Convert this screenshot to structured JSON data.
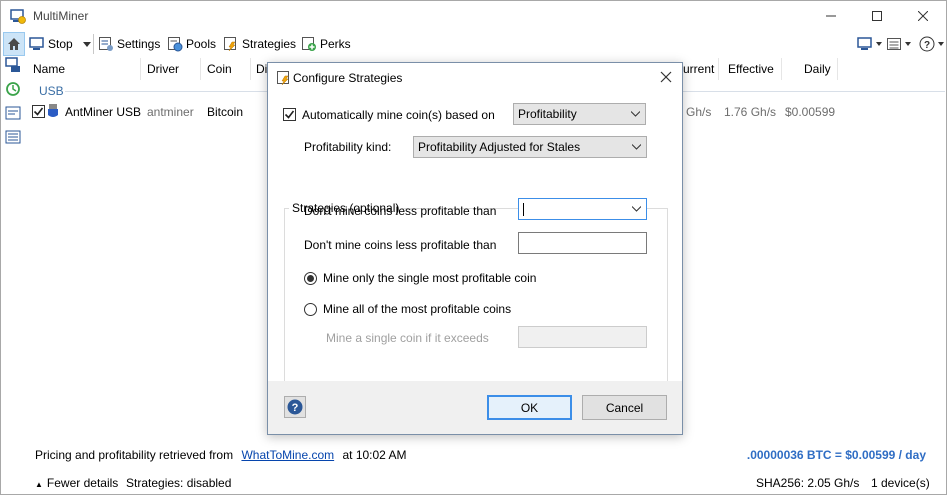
{
  "window": {
    "title": "MultiMiner"
  },
  "toolbar": {
    "stop_label": "Stop",
    "settings_label": "Settings",
    "pools_label": "Pools",
    "strategies_label": "Strategies",
    "perks_label": "Perks"
  },
  "list": {
    "columns": {
      "name": "Name",
      "driver": "Driver",
      "coin": "Coin",
      "difficulty_partial": "Di",
      "current_partial": "urrent",
      "effective": "Effective",
      "daily": "Daily"
    },
    "group_label": "USB",
    "row": {
      "name": "AntMiner USB",
      "driver": "antminer",
      "coin": "Bitcoin",
      "current_partial": "Gh/s",
      "effective": "1.76 Gh/s",
      "daily": "$0.00599"
    }
  },
  "status": {
    "pricing_text": "Pricing and profitability retrieved from",
    "pricing_link": "WhatToMine.com",
    "pricing_time": "at 10:02 AM",
    "earnings": ".00000036 BTC = $0.00599 / day",
    "fewer_details": "Fewer details",
    "strategies_state": "Strategies: disabled",
    "hashrate": "SHA256: 2.05 Gh/s",
    "device_count": "1 device(s)"
  },
  "dialog": {
    "title": "Configure Strategies",
    "auto_mine_label": "Automatically mine coin(s) based on",
    "auto_mine_checked": true,
    "based_on_value": "Profitability",
    "profit_kind_label": "Profitability kind:",
    "profit_kind_value": "Profitability Adjusted for Stales",
    "strategies_group": "Strategies (optional)",
    "min_profit_label_1": "Don't mine coins less profitable than",
    "min_profit_value_1": "",
    "min_profit_label_2": "Don't mine coins less profitable than",
    "min_profit_value_2": "",
    "radio_single": "Mine only the single most profitable coin",
    "radio_all": "Mine all of the most profitable coins",
    "single_threshold_label": "Mine a single coin if it exceeds",
    "single_threshold_value": "",
    "ok_label": "OK",
    "cancel_label": "Cancel"
  },
  "colors": {
    "accent": "#3c8ee8",
    "link": "#0645ad",
    "earnings": "#2f6dc4",
    "group_text": "#3a6ea5"
  }
}
